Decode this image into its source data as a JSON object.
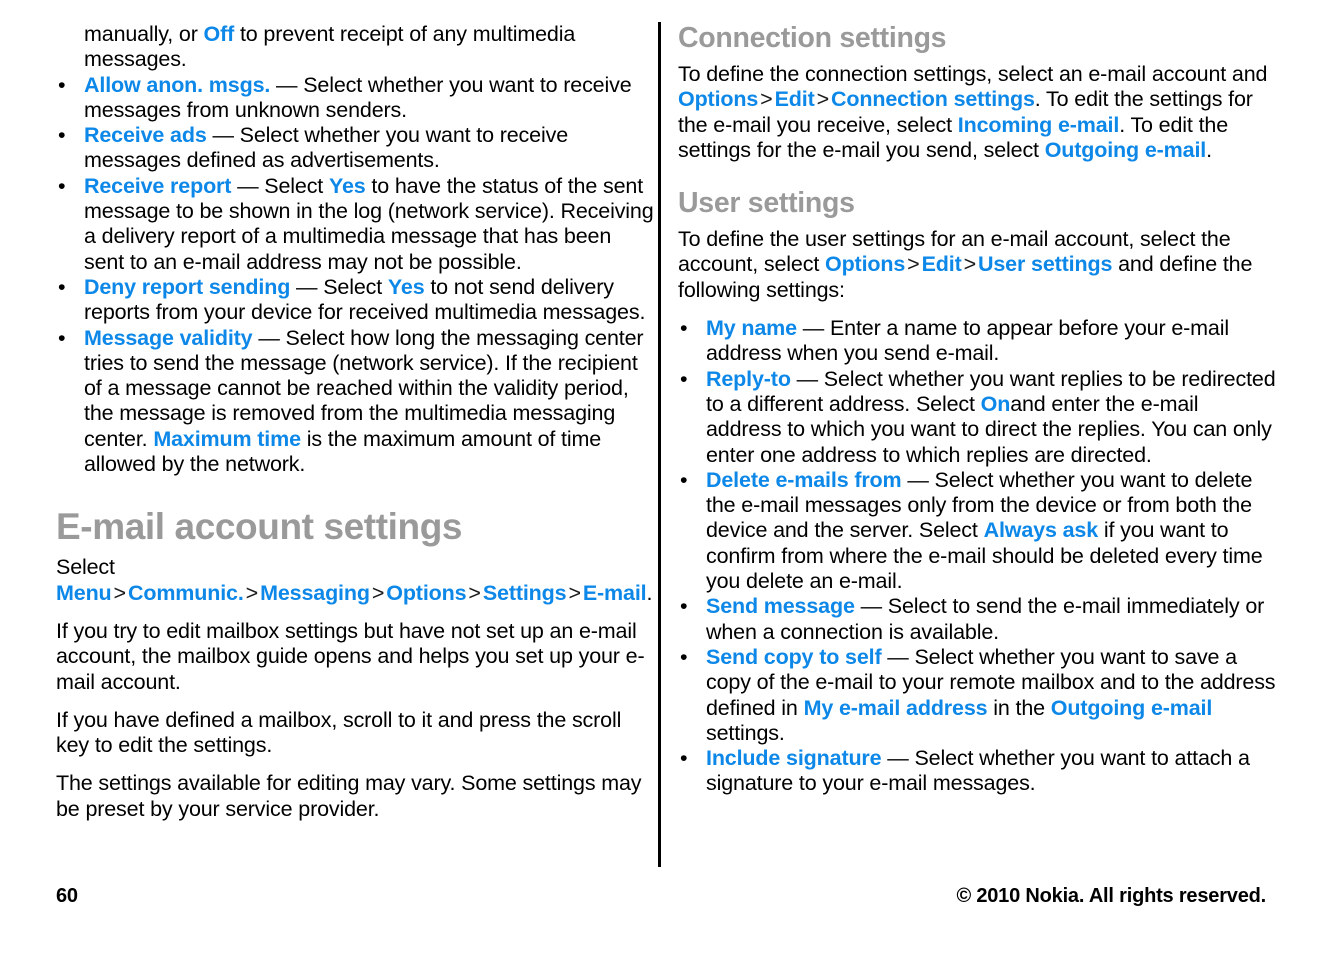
{
  "document": {
    "page_number": "60",
    "copyright": "© 2010 Nokia. All rights reserved.",
    "link_color": "#0d88e8",
    "heading_color": "#9a9a9a",
    "body_color": "#000000",
    "bullet_glyph": "•"
  },
  "left_column": {
    "continued_bullet": {
      "text_before": "manually, or ",
      "link": "Off",
      "text_after": " to prevent receipt of any multimedia messages."
    },
    "bullets": [
      {
        "term": "Allow anon. msgs.",
        "body": " — Select whether you want to receive messages from unknown senders."
      },
      {
        "term": "Receive ads",
        "body": " — Select whether you want to receive messages defined as advertisements."
      },
      {
        "term": "Receive report",
        "body_1": " — Select ",
        "inline_link_1": "Yes",
        "body_2": " to have the status of the sent message to be shown in the log (network service). Receiving a delivery report of a multimedia message that has been sent to an e-mail address may not be possible."
      },
      {
        "term": "Deny report sending",
        "body_1": " — Select ",
        "inline_link_1": "Yes",
        "body_2": " to not send delivery reports from your device for received multimedia messages."
      },
      {
        "term": "Message validity",
        "body_1": " — Select how long the messaging center tries to send the message (network service). If the recipient of a message cannot be reached within the validity period, the message is removed from the multimedia messaging center. ",
        "inline_link_1": "Maximum time",
        "body_2": " is the maximum amount of time allowed by the network."
      }
    ],
    "section": {
      "title": "E-mail account settings",
      "path_intro": "Select ",
      "path": [
        "Menu",
        "Communic.",
        "Messaging",
        "Options",
        "Settings",
        "E-mail"
      ],
      "path_separator": ">",
      "path_end": ".",
      "paragraphs": [
        "If you try to edit mailbox settings but have not set up an e-mail account, the mailbox guide opens and helps you set up your e-mail account.",
        "If you have defined a mailbox, scroll to it and press the scroll key to edit the settings.",
        "The settings available for editing may vary. Some settings may be preset by your service provider."
      ]
    }
  },
  "right_column": {
    "connection_settings": {
      "title": "Connection settings",
      "p1_a": "To define the connection settings, select an e-mail account and ",
      "p1_link1": "Options",
      "p1_link2": "Edit",
      "p1_link3": "Connection settings",
      "p1_b": ". To edit the settings for the e-mail you receive, select ",
      "p1_link4": "Incoming e-mail",
      "p1_c": ". To edit the settings for the e-mail you send, select ",
      "p1_link5": "Outgoing e-mail",
      "p1_d": "."
    },
    "user_settings": {
      "title": "User settings",
      "p1_a": "To define the user settings for an e-mail account, select the account, select ",
      "p1_link1": "Options",
      "p1_link2": "Edit",
      "p1_link3": "User settings",
      "p1_b": " and define the following settings:",
      "bullets": [
        {
          "term": "My name",
          "body": " — Enter a name to appear before your e-mail address when you send e-mail."
        },
        {
          "term": "Reply-to",
          "body_1": " — Select whether you want replies to be redirected to a different address. Select ",
          "inline_link_1": "On",
          "body_2": "and enter the e-mail address to which you want to direct the replies. You can only enter one address to which replies are directed."
        },
        {
          "term": "Delete e-mails from",
          "body_1": " — Select whether you want to delete the e-mail messages only from the device or from both the device and the server. Select ",
          "inline_link_1": "Always ask",
          "body_2": " if you want to confirm from where the e-mail should be deleted every time you delete an e-mail."
        },
        {
          "term": "Send message",
          "body": " — Select to send the e-mail immediately or when a connection is available."
        },
        {
          "term": "Send copy to self",
          "body_1": " — Select whether you want to save a copy of the e-mail to your remote mailbox and to the address defined in ",
          "inline_link_1": "My e-mail address",
          "body_2": " in the ",
          "inline_link_2": "Outgoing e-mail",
          "body_3": " settings."
        },
        {
          "term": "Include signature",
          "body": " — Select whether you want to attach a signature to your e-mail messages."
        }
      ]
    }
  }
}
